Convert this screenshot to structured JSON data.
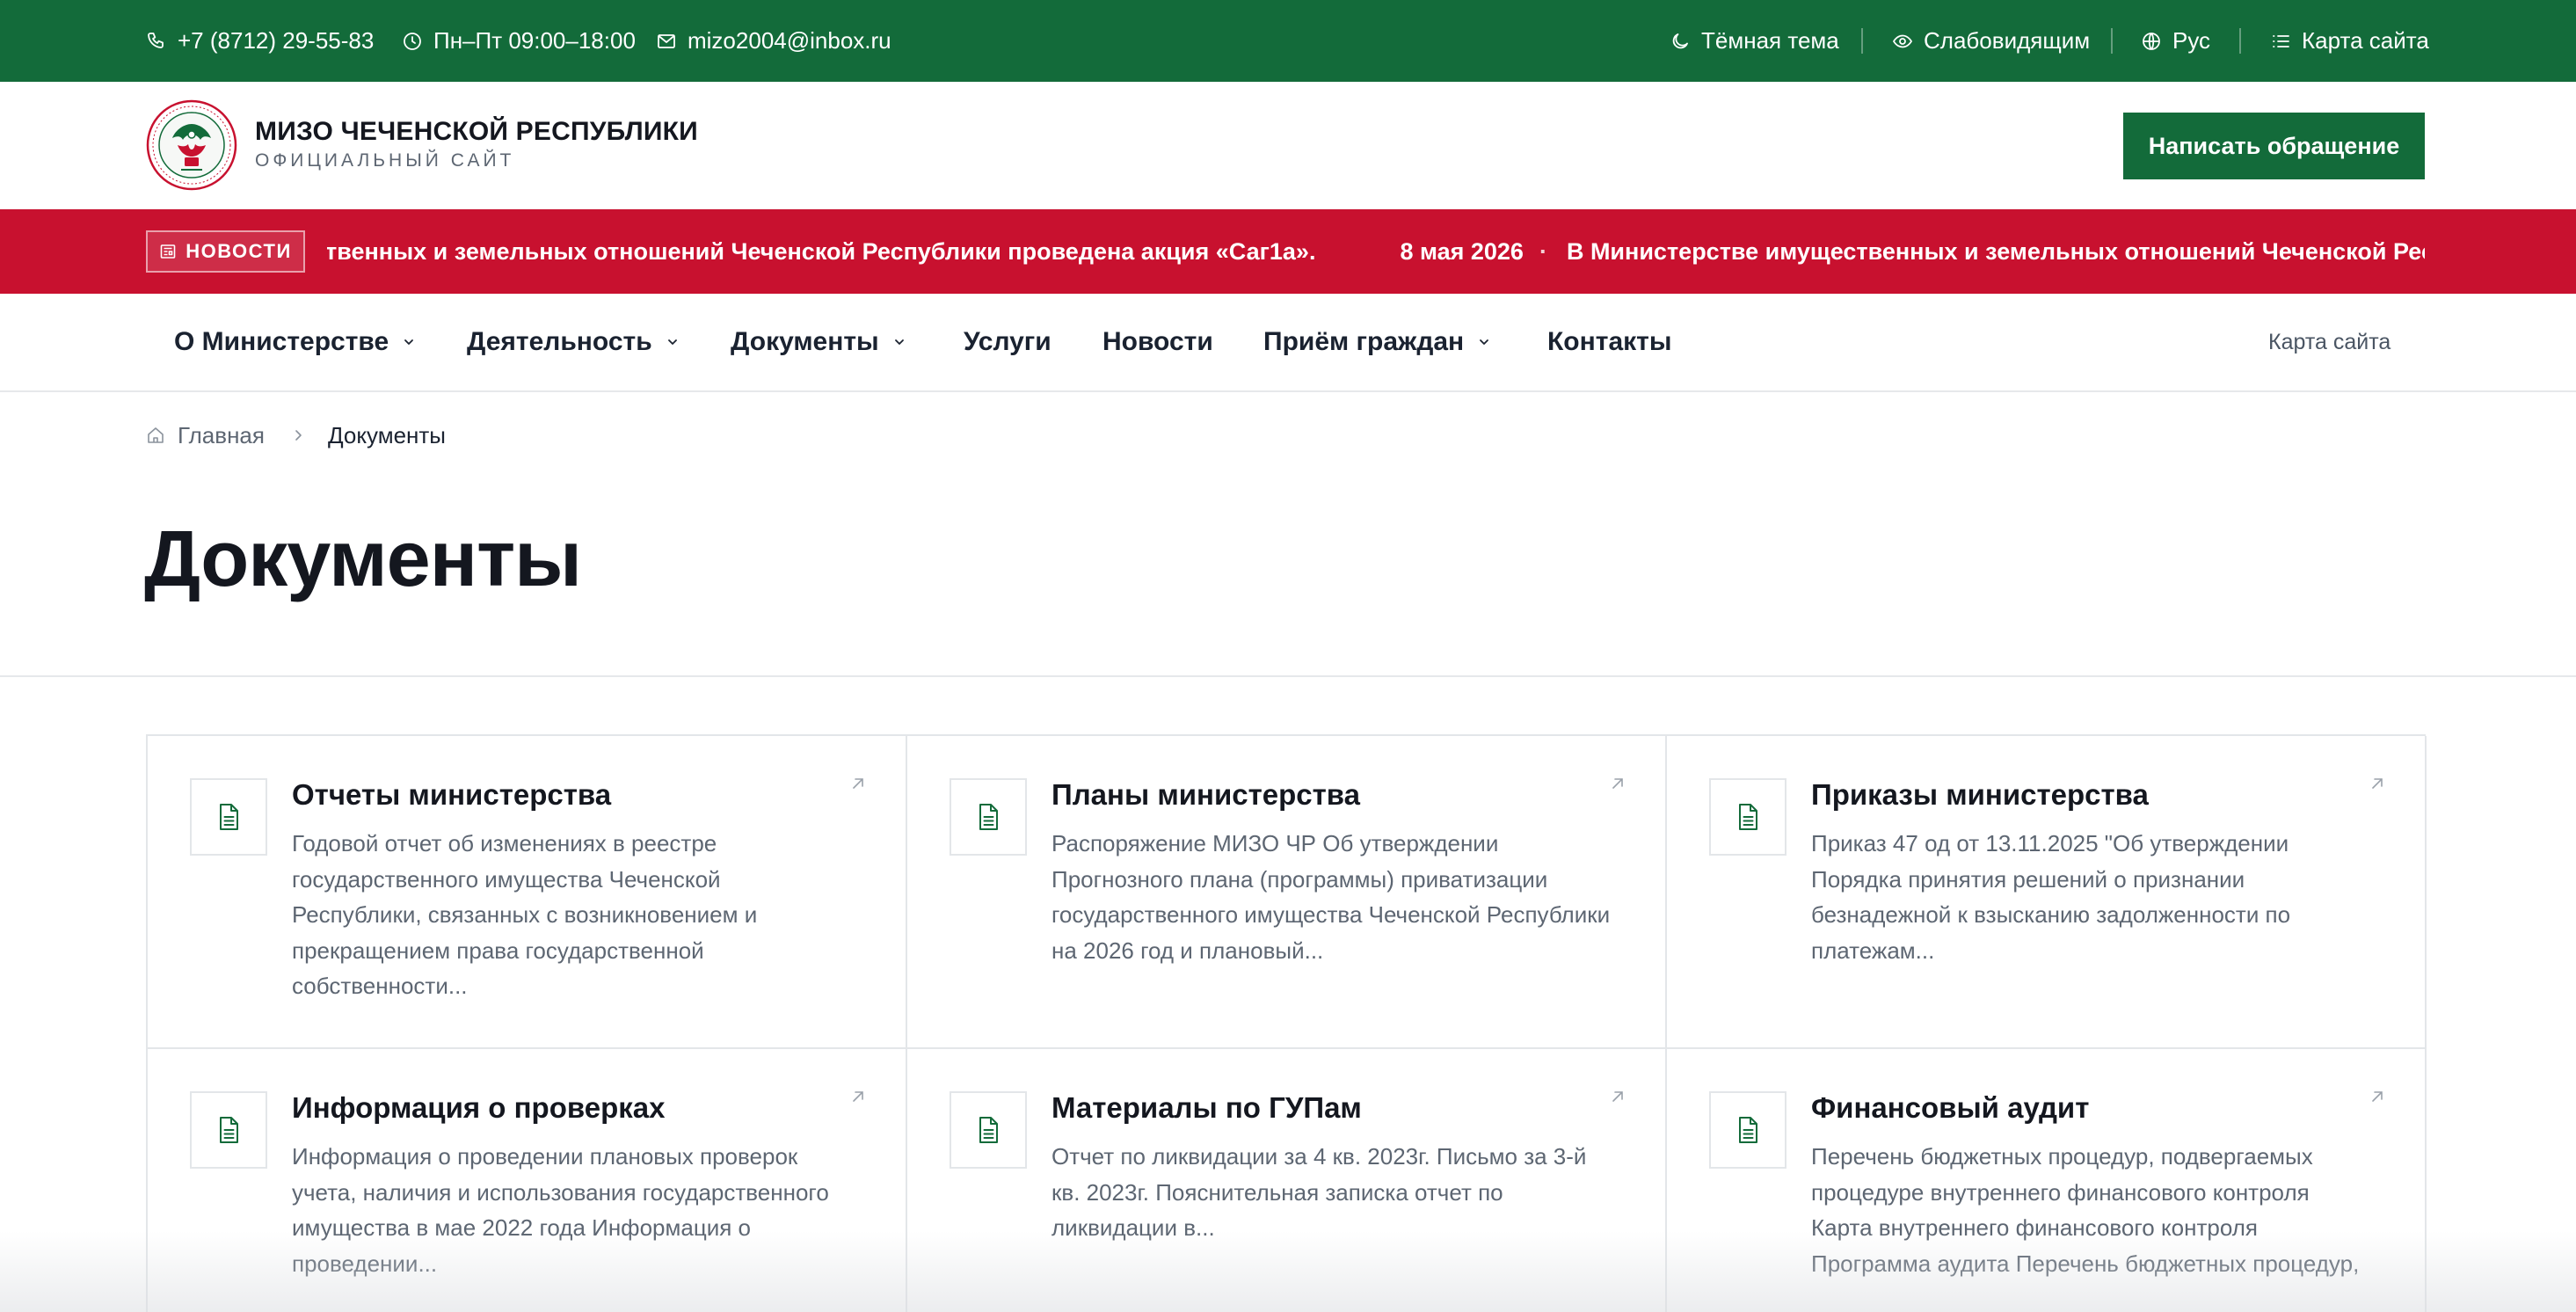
{
  "topbar": {
    "phone": "+7 (8712) 29-55-83",
    "hours": "Пн–Пт 09:00–18:00",
    "email": "mizo2004@inbox.ru",
    "dark_theme": "Тёмная тема",
    "low_vision": "Слабовидящим",
    "language": "Рус",
    "sitemap": "Карта сайта"
  },
  "header": {
    "title": "МИЗО ЧЕЧЕНСКОЙ РЕСПУБЛИКИ",
    "subtitle": "ОФИЦИАЛЬНЫЙ САЙТ",
    "cta": "Написать обращение"
  },
  "ticker": {
    "badge": "НОВОСТИ",
    "lead_fragment": "твенных и земельных отношений Чеченской Республики проведена акция «Саг1а».",
    "date": "8 мая 2026",
    "dot": "·",
    "headline": "В Министерстве имущественных и земельных отношений Чеченской Республики"
  },
  "nav": {
    "items": [
      "О Министерстве",
      "Деятельность",
      "Документы",
      "Услуги",
      "Новости",
      "Приём граждан",
      "Контакты"
    ],
    "sitemap": "Карта сайта"
  },
  "breadcrumb": {
    "home": "Главная",
    "current": "Документы"
  },
  "page": {
    "title": "Документы"
  },
  "cards": [
    {
      "title": "Отчеты министерства",
      "description": "Годовой отчет об изменениях в реестре государственного имущества Чеченской Республики, связанных с возникновением и прекращением права государственной собственности..."
    },
    {
      "title": "Планы министерства",
      "description": "Распоряжение МИЗО ЧР Об утверждении Прогнозного плана (программы) приватизации государственного имущества Чеченской Республики на 2026 год и плановый..."
    },
    {
      "title": "Приказы министерства",
      "description": "Приказ 47 од от 13.11.2025 \"Об утверждении Порядка принятия решений о признании безнадежной к взысканию задолженности по платежам..."
    },
    {
      "title": "Информация о проверках",
      "description": "Информация о проведении плановых проверок учета, наличия и использования государственного имущества в мае 2022 года Информация о проведении..."
    },
    {
      "title": "Материалы по ГУПам",
      "description": "Отчет по ликвидации за 4 кв. 2023г. Письмо за 3-й кв. 2023г. Пояснительная записка отчет по ликвидации в..."
    },
    {
      "title": "Финансовый аудит",
      "description": "Перечень бюджетных процедур, подвергаемых процедуре внутреннего финансового контроля Карта внутреннего финансового контроля Программа аудита Перечень бюджетных процедур,"
    }
  ],
  "colors": {
    "brand_green": "#136b3a",
    "ticker_red": "#c8112f",
    "text_dark": "#14171f",
    "text_muted": "#5d6672",
    "border": "#e3e6e9"
  },
  "icons": {
    "phone": "phone-icon",
    "clock": "clock-icon",
    "mail": "mail-icon",
    "moon": "moon-icon",
    "eye": "eye-icon",
    "globe": "globe-icon",
    "list": "list-icon",
    "newspaper": "newspaper-icon",
    "chevron": "chevron-down-icon",
    "home": "home-icon",
    "document": "document-icon",
    "arrow": "arrow-up-right-icon"
  }
}
